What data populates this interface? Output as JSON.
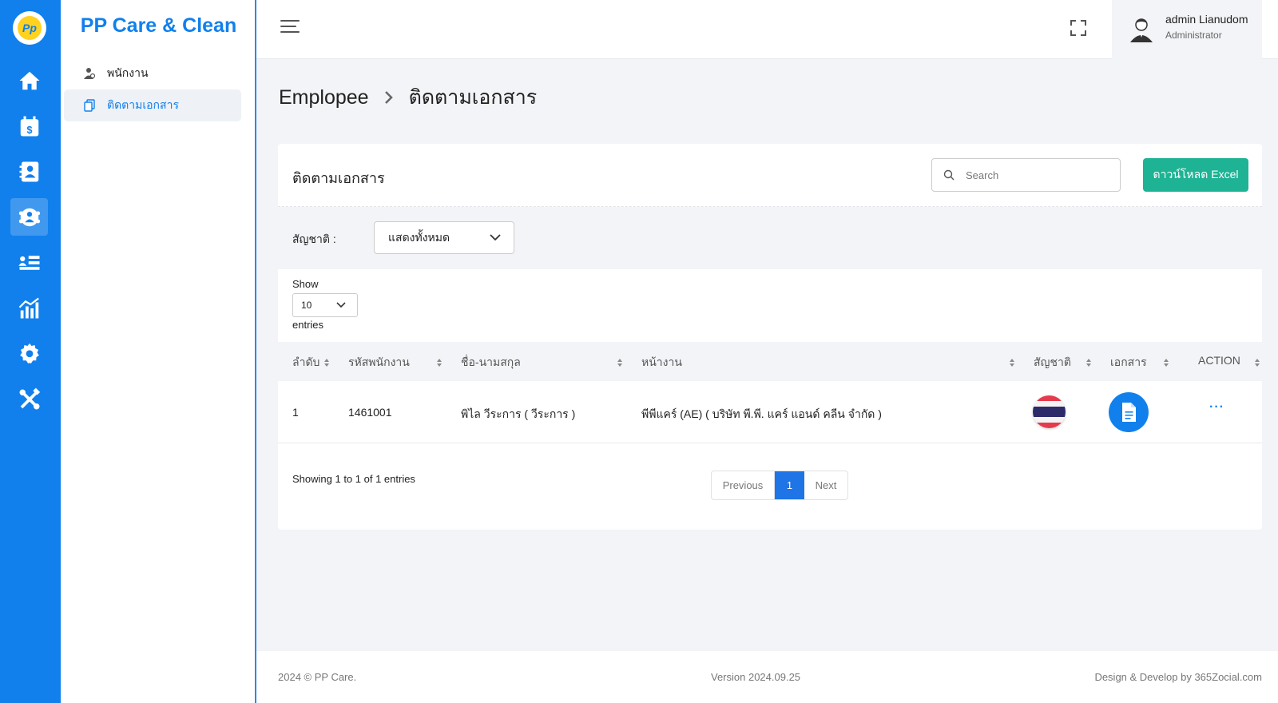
{
  "app": {
    "brand": "PP Care & Clean",
    "logo_text": "Pp"
  },
  "rail": {
    "items": [
      {
        "icon": "home-icon"
      },
      {
        "icon": "calendar-dollar-icon"
      },
      {
        "icon": "contact-book-icon"
      },
      {
        "icon": "team-icon",
        "active": true
      },
      {
        "icon": "user-list-icon"
      },
      {
        "icon": "chart-icon"
      },
      {
        "icon": "gear-icon"
      },
      {
        "icon": "tools-icon"
      }
    ]
  },
  "sidebar": {
    "items": [
      {
        "label": "พนักงาน",
        "icon": "employee-icon"
      },
      {
        "label": "ติดตามเอกสาร",
        "icon": "document-copy-icon",
        "active": true
      }
    ]
  },
  "header": {
    "user_name": "admin Lianudom",
    "user_role": "Administrator"
  },
  "breadcrumb": {
    "parent": "Emplopee",
    "current": "ติดตามเอกสาร"
  },
  "card": {
    "title": "ติดตามเอกสาร",
    "search_placeholder": "Search",
    "excel_button": "ดาวน์โหลด Excel"
  },
  "filter": {
    "label": "สัญชาติ :",
    "value": "แสดงทั้งหมด"
  },
  "length": {
    "show": "Show",
    "value": "10",
    "entries": "entries"
  },
  "table": {
    "headers": [
      "ลำดับ",
      "รหัสพนักงาน",
      "ชื่อ-นามสกุล",
      "หน้างาน",
      "สัญชาติ",
      "เอกสาร",
      "ACTION"
    ],
    "rows": [
      {
        "no": "1",
        "code": "1461001",
        "name": "พิไล วีระการ ( วีระการ )",
        "site": "พีพีแคร์ (AE) ( บริษัท พี.พี. แคร์ แอนด์ คลีน จำกัด )",
        "nationality_icon": "thailand-flag-icon",
        "action": "···"
      }
    ]
  },
  "pagination": {
    "info": "Showing 1 to 1 of 1 entries",
    "previous": "Previous",
    "current": "1",
    "next": "Next"
  },
  "footer": {
    "copyright": "2024 © PP Care.",
    "version": "Version 2024.09.25",
    "credit": "Design & Develop by 365Zocial.com"
  },
  "colors": {
    "primary": "#1180ec",
    "success": "#1db394",
    "page_bg": "#f3f4f7"
  }
}
